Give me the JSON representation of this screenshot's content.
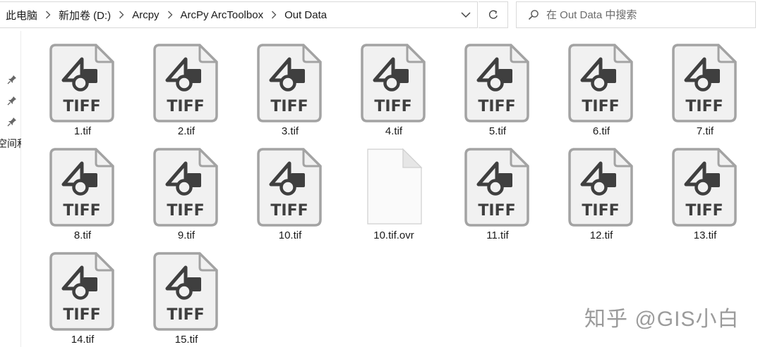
{
  "breadcrumb": {
    "items": [
      "此电脑",
      "新加卷 (D:)",
      "Arcpy",
      "ArcPy ArcToolbox",
      "Out Data"
    ]
  },
  "search": {
    "placeholder": "在 Out Data 中搜索"
  },
  "navpane": {
    "quick_access_label": "空间和"
  },
  "files": [
    {
      "name": "1.tif",
      "type": "tiff",
      "badge": "TIFF"
    },
    {
      "name": "2.tif",
      "type": "tiff",
      "badge": "TIFF"
    },
    {
      "name": "3.tif",
      "type": "tiff",
      "badge": "TIFF"
    },
    {
      "name": "4.tif",
      "type": "tiff",
      "badge": "TIFF"
    },
    {
      "name": "5.tif",
      "type": "tiff",
      "badge": "TIFF"
    },
    {
      "name": "6.tif",
      "type": "tiff",
      "badge": "TIFF"
    },
    {
      "name": "7.tif",
      "type": "tiff",
      "badge": "TIFF"
    },
    {
      "name": "8.tif",
      "type": "tiff",
      "badge": "TIFF"
    },
    {
      "name": "9.tif",
      "type": "tiff",
      "badge": "TIFF"
    },
    {
      "name": "10.tif",
      "type": "tiff",
      "badge": "TIFF"
    },
    {
      "name": "10.tif.ovr",
      "type": "generic",
      "badge": ""
    },
    {
      "name": "11.tif",
      "type": "tiff",
      "badge": "TIFF"
    },
    {
      "name": "12.tif",
      "type": "tiff",
      "badge": "TIFF"
    },
    {
      "name": "13.tif",
      "type": "tiff",
      "badge": "TIFF"
    },
    {
      "name": "14.tif",
      "type": "tiff",
      "badge": "TIFF"
    },
    {
      "name": "15.tif",
      "type": "tiff",
      "badge": "TIFF"
    }
  ],
  "watermark": "知乎 @GIS小白",
  "colors": {
    "icon_border": "#a3a3a3",
    "icon_fill": "#f1f1f1",
    "glyph": "#3f3f3f"
  }
}
